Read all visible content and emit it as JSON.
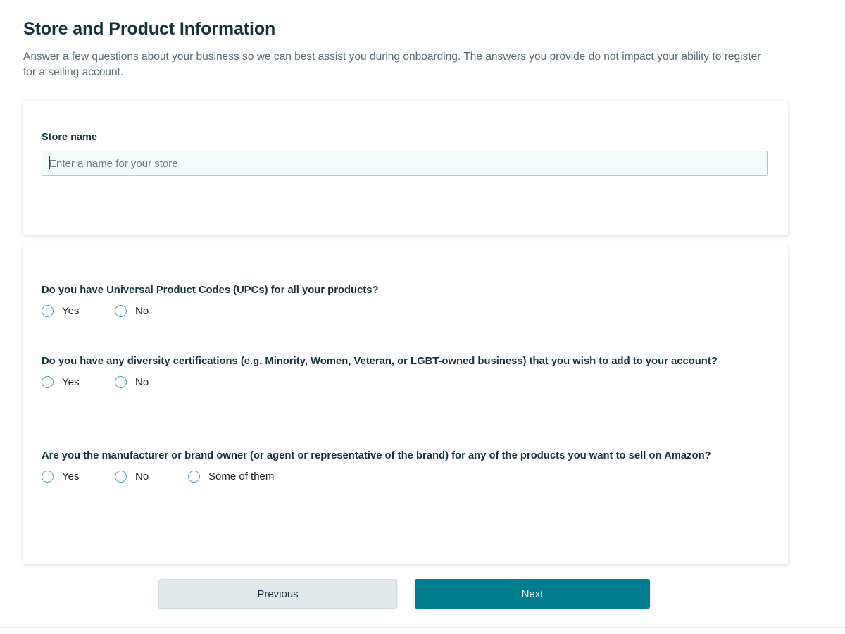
{
  "header": {
    "title": "Store and Product Information",
    "description": "Answer a few questions about your business so we can best assist you during onboarding. The answers you provide do not impact your ability to register for a selling account."
  },
  "store_section": {
    "label": "Store name",
    "placeholder": "Enter a name for your store",
    "value": ""
  },
  "questions": [
    {
      "text": "Do you have Universal Product Codes (UPCs) for all your products?",
      "options": [
        {
          "label": "Yes",
          "selected": false
        },
        {
          "label": "No",
          "selected": false
        }
      ]
    },
    {
      "text": "Do you have any diversity certifications (e.g. Minority, Women, Veteran, or LGBT-owned business) that you wish to add to your account?",
      "options": [
        {
          "label": "Yes",
          "selected": false
        },
        {
          "label": "No",
          "selected": false
        }
      ]
    },
    {
      "text": "Are you the manufacturer or brand owner (or agent or representative of the brand) for any of the products you want to sell on Amazon?",
      "options": [
        {
          "label": "Yes",
          "selected": false
        },
        {
          "label": "No",
          "selected": false
        },
        {
          "label": "Some of them",
          "selected": false
        }
      ]
    }
  ],
  "footer": {
    "previous_label": "Previous",
    "next_label": "Next"
  },
  "colors": {
    "accent_teal": "#007d8f",
    "title_navy": "#17313c",
    "radio_border": "#4fa3b8",
    "input_border": "#a7cfcb",
    "input_fill": "#f4fcfb",
    "secondary_button": "#e1e9eb",
    "body_text": "#5b6a72"
  }
}
